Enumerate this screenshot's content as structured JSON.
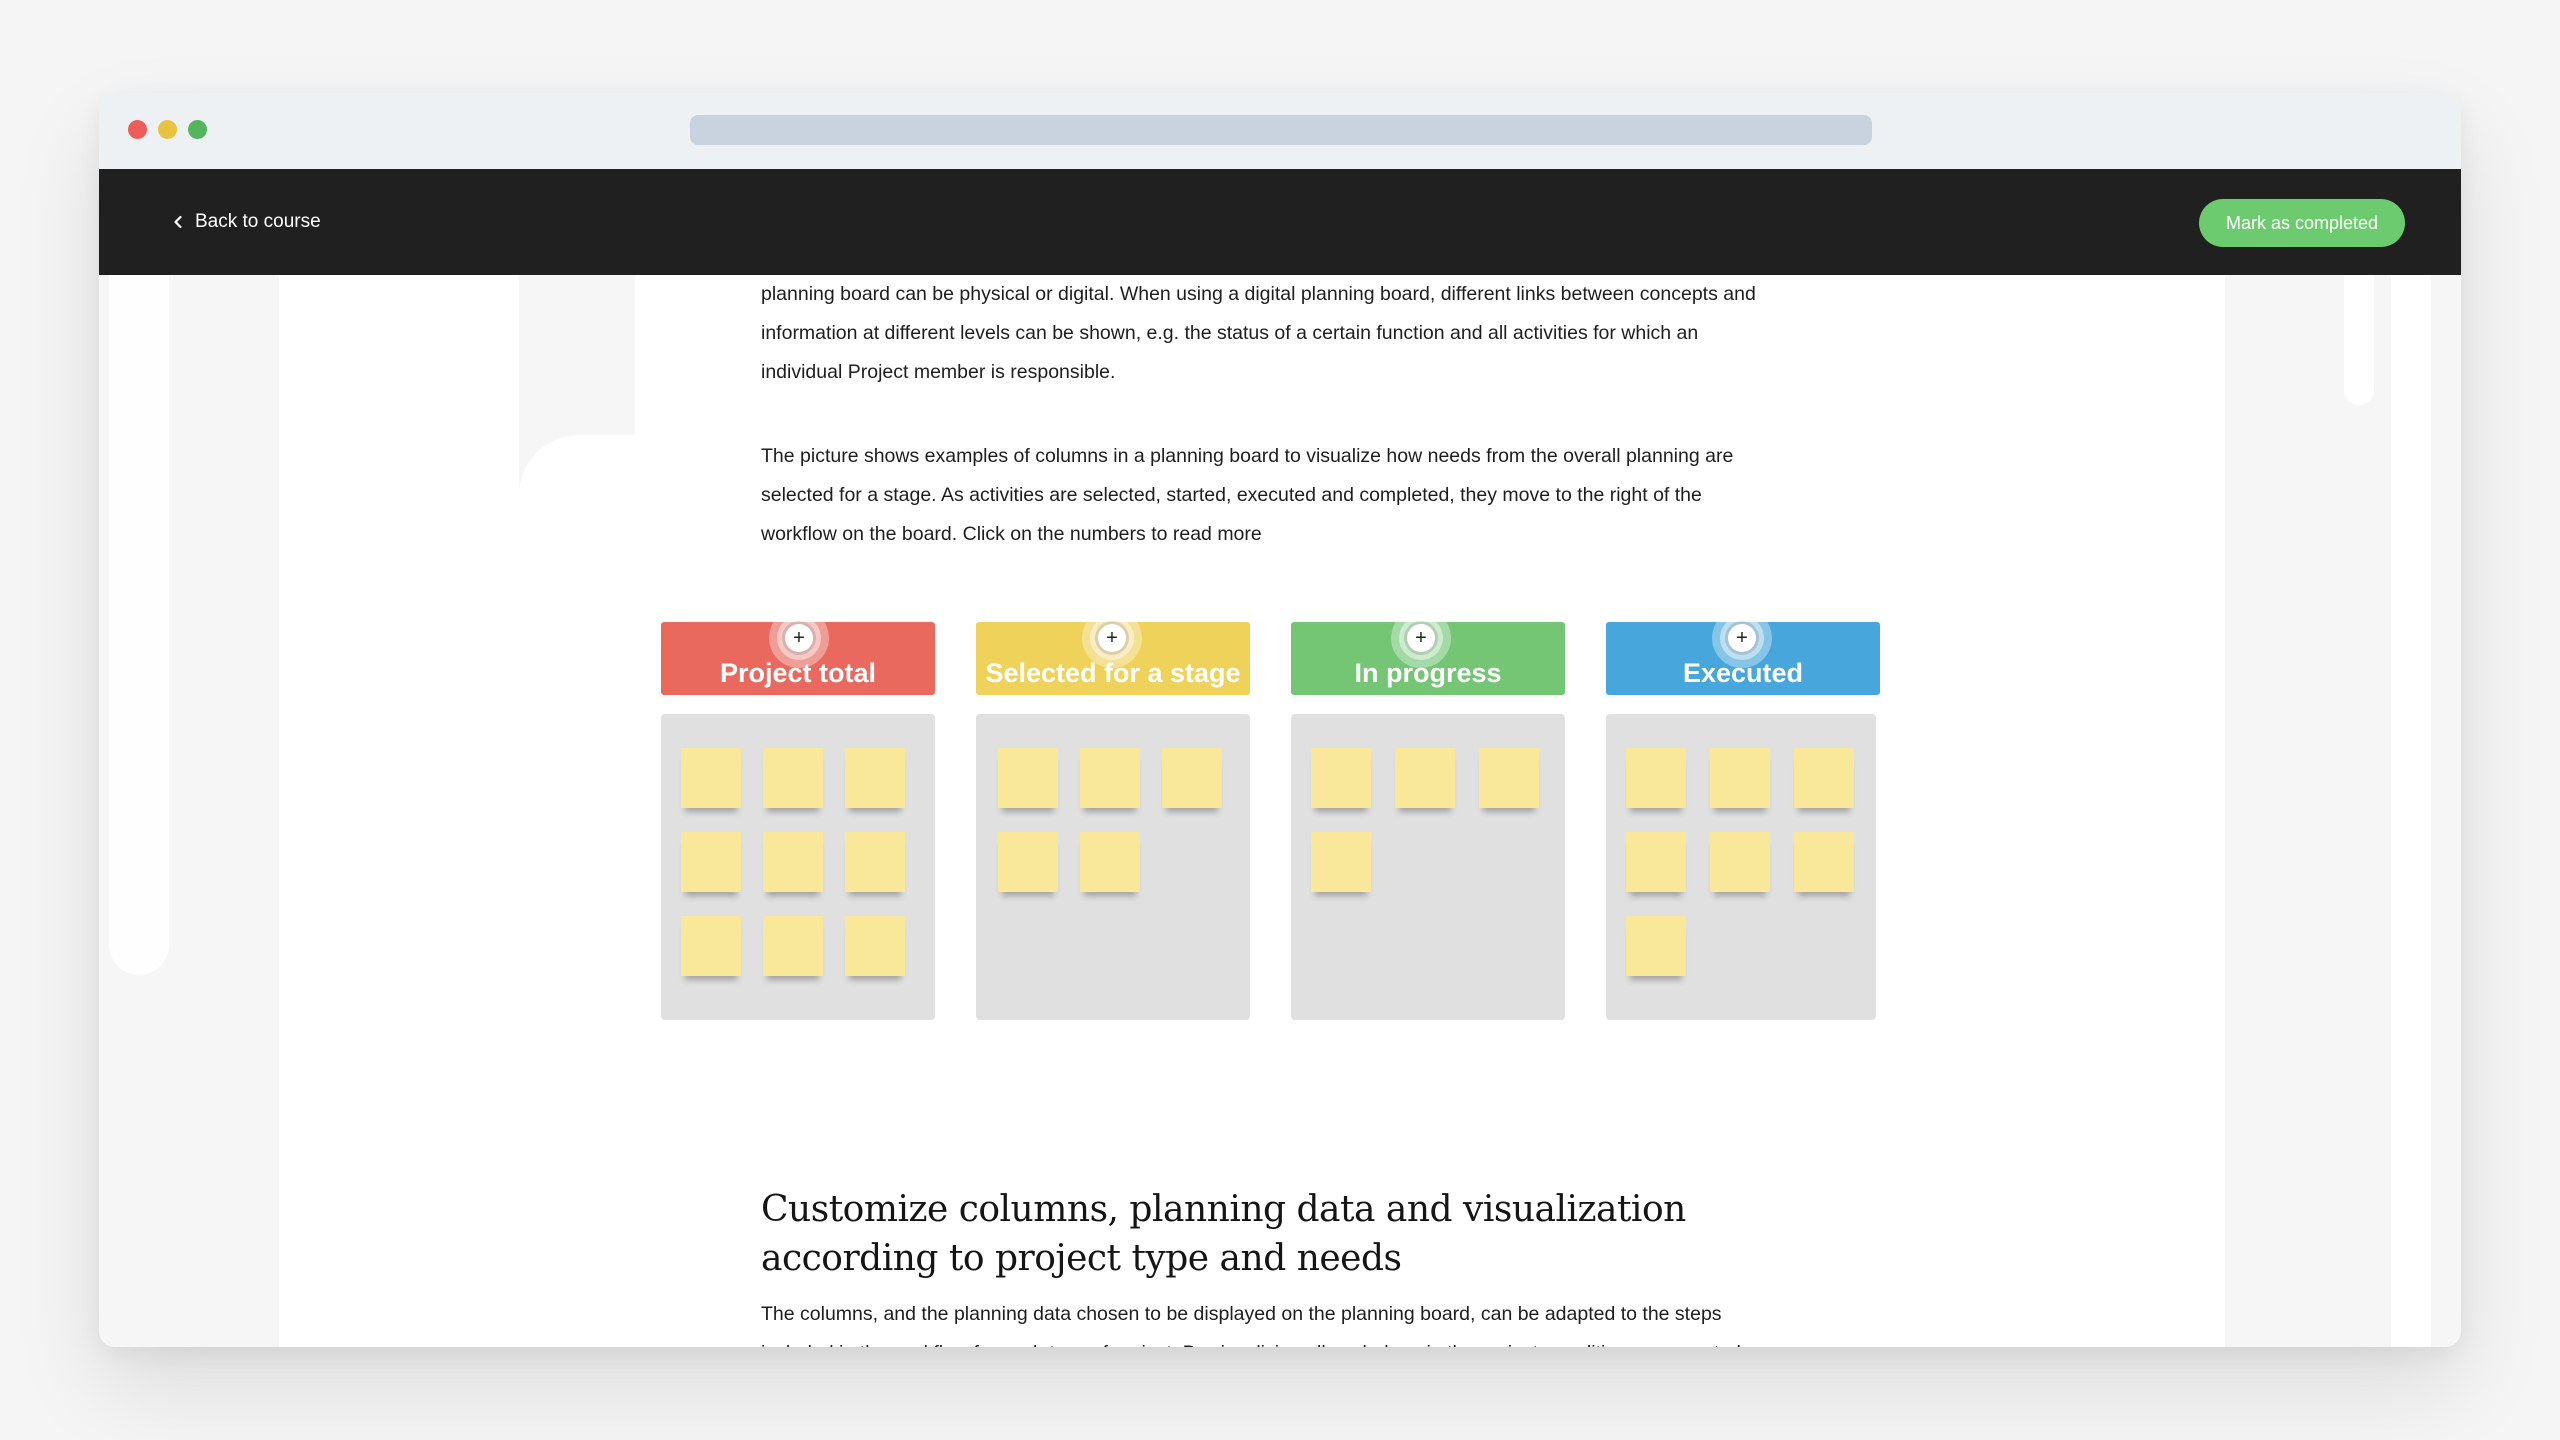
{
  "nav": {
    "back_label": "Back to course",
    "mark_completed_label": "Mark as completed"
  },
  "paragraph1": "planning board can be physical or digital. When using a digital planning board, different links between concepts and information at different levels can be shown, e.g. the status of a certain function and all activities for which an individual Project member is responsible.",
  "paragraph2": "The picture shows examples of columns in a planning board to visualize how needs from the overall planning are selected for a stage. As activities are selected, started, executed and completed, they move to the right of the workflow on the board. Click on the numbers to read more",
  "board": {
    "columns": [
      {
        "label": "Project total",
        "color": "#e9695e",
        "note_count": 9
      },
      {
        "label": "Selected for a stage",
        "color": "#efd25a",
        "note_count": 5
      },
      {
        "label": "In progress",
        "color": "#74c675",
        "note_count": 4
      },
      {
        "label": "Executed",
        "color": "#47a6dc",
        "note_count": 7
      }
    ],
    "hotspot_symbol": "+"
  },
  "section_heading": "Customize columns, planning data and visualization according to project type and needs",
  "paragraph3": "The columns, and the planning data chosen to be displayed on the planning board, can be adapted to the steps included in the workflow for each type of project. By visualizing all work done in the project, conditions are created for open communication and a clarity in the way of working."
}
